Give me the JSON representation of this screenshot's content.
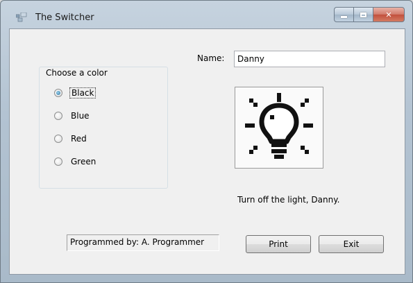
{
  "window": {
    "title": "The Switcher",
    "icon": "app-icon"
  },
  "name_field": {
    "label": "Name:",
    "value": "Danny"
  },
  "color_group": {
    "title": "Choose a color",
    "options": [
      {
        "label": "Black",
        "checked": true
      },
      {
        "label": "Blue",
        "checked": false
      },
      {
        "label": "Red",
        "checked": false
      },
      {
        "label": "Green",
        "checked": false
      }
    ]
  },
  "picture": {
    "icon": "lightbulb-icon"
  },
  "message": "Turn off the light, Danny.",
  "author": "Programmed by: A. Programmer",
  "buttons": {
    "print": "Print",
    "exit": "Exit"
  },
  "colors": {
    "close_button": "#c2503d",
    "window_frame": "#b3c3d2",
    "client_bg": "#f0f0f0"
  }
}
